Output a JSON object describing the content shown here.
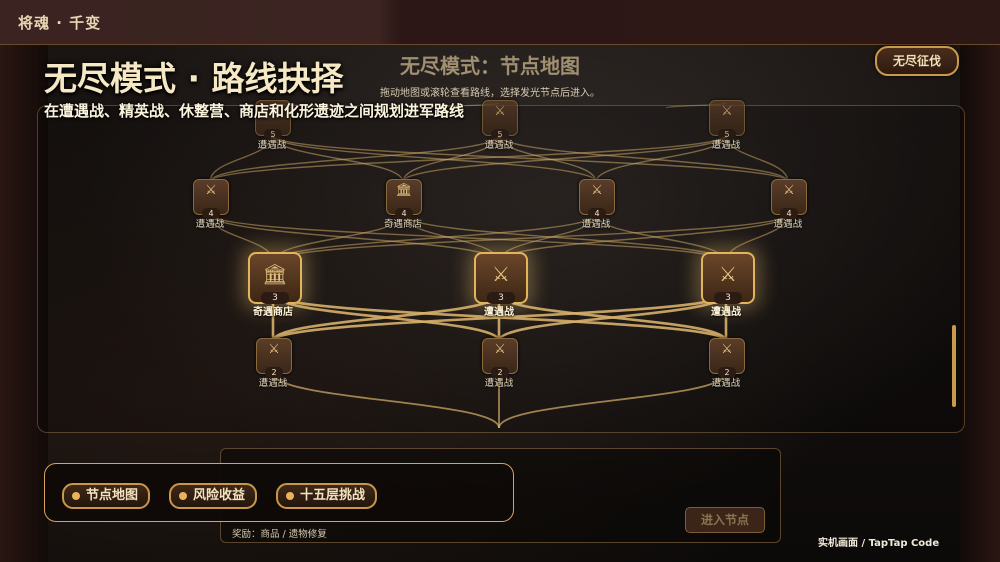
{
  "app_title": "将魂 · 千变",
  "main_title": "无尽模式 · 路线抉择",
  "subtitle": "在遭遇战、精英战、休整营、商店和化形遗迹之间规划进军路线",
  "panel": {
    "title": "无尽模式：节点地图",
    "hint": "拖动地图或滚轮查看路线，选择发光节点后进入。"
  },
  "endless_button": "无尽征伐",
  "map_rows": [
    {
      "level": "5",
      "nodes": [
        {
          "label": "遭遇战",
          "icon": "sword-icon",
          "selectable": false
        },
        {
          "label": "遭遇战",
          "icon": "sword-icon",
          "selectable": false
        },
        {
          "label": "遭遇战",
          "icon": "sword-icon",
          "selectable": false
        }
      ]
    },
    {
      "level": "4",
      "nodes": [
        {
          "label": "遭遇战",
          "icon": "sword-icon",
          "selectable": false
        },
        {
          "label": "奇遇商店",
          "icon": "shop-icon",
          "selectable": false
        },
        {
          "label": "遭遇战",
          "icon": "sword-icon",
          "selectable": false
        },
        {
          "label": "遭遇战",
          "icon": "sword-icon",
          "selectable": false
        }
      ]
    },
    {
      "level": "3",
      "nodes": [
        {
          "label": "奇遇商店",
          "icon": "shop-icon",
          "selectable": true
        },
        {
          "label": "遭遇战",
          "icon": "sword-icon",
          "selectable": true
        },
        {
          "label": "遭遇战",
          "icon": "sword-icon",
          "selectable": true
        }
      ]
    },
    {
      "level": "2",
      "nodes": [
        {
          "label": "遭遇战",
          "icon": "sword-icon",
          "selectable": false
        },
        {
          "label": "遭遇战",
          "icon": "sword-icon",
          "selectable": false
        },
        {
          "label": "遭遇战",
          "icon": "sword-icon",
          "selectable": false
        }
      ]
    }
  ],
  "tabs": [
    "节点地图",
    "风险收益",
    "十五层挑战"
  ],
  "reward_text": "奖励：商品 / 遗物修复",
  "enter_button": "进入节点",
  "credit": "实机画面 / TapTap Code",
  "colors": {
    "accent": "#e2b45c",
    "path": "#d6b06a"
  }
}
